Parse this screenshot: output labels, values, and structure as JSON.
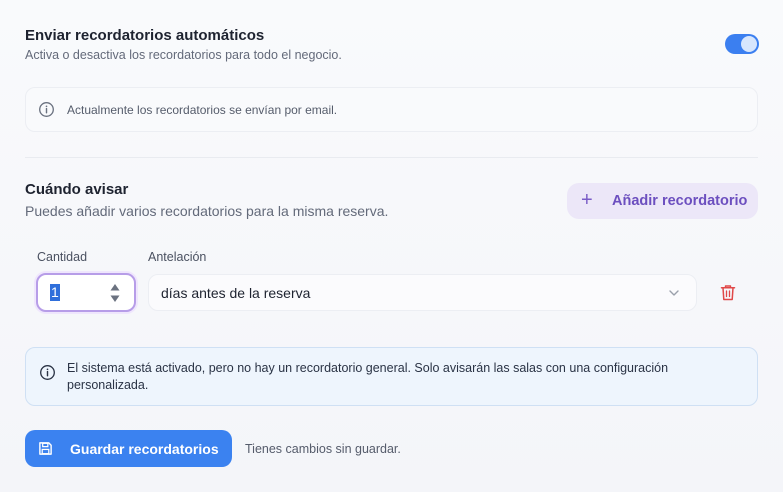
{
  "auto_reminders": {
    "title": "Enviar recordatorios automáticos",
    "subtitle": "Activa o desactiva los recordatorios para todo el negocio.",
    "enabled": true,
    "info": "Actualmente los recordatorios se envían por email."
  },
  "when": {
    "title": "Cuándo avisar",
    "subtitle": "Puedes añadir varios recordatorios para la misma reserva.",
    "add_button": "Añadir recordatorio"
  },
  "reminder_row": {
    "quantity_label": "Cantidad",
    "quantity_value": "1",
    "advance_label": "Antelación",
    "advance_value": "días antes de la reserva"
  },
  "notice": "El sistema está activado, pero no hay un recordatorio general. Solo avisarán las salas con una configuración personalizada.",
  "footer": {
    "save_button": "Guardar recordatorios",
    "status": "Tienes cambios sin guardar."
  },
  "colors": {
    "accent_blue": "#3b82f0",
    "purple": "#6c4fbf",
    "danger": "#e04848"
  },
  "icons": [
    "info-icon",
    "plus-icon",
    "spinner-icon",
    "chevron-down-icon",
    "trash-icon",
    "save-icon"
  ]
}
